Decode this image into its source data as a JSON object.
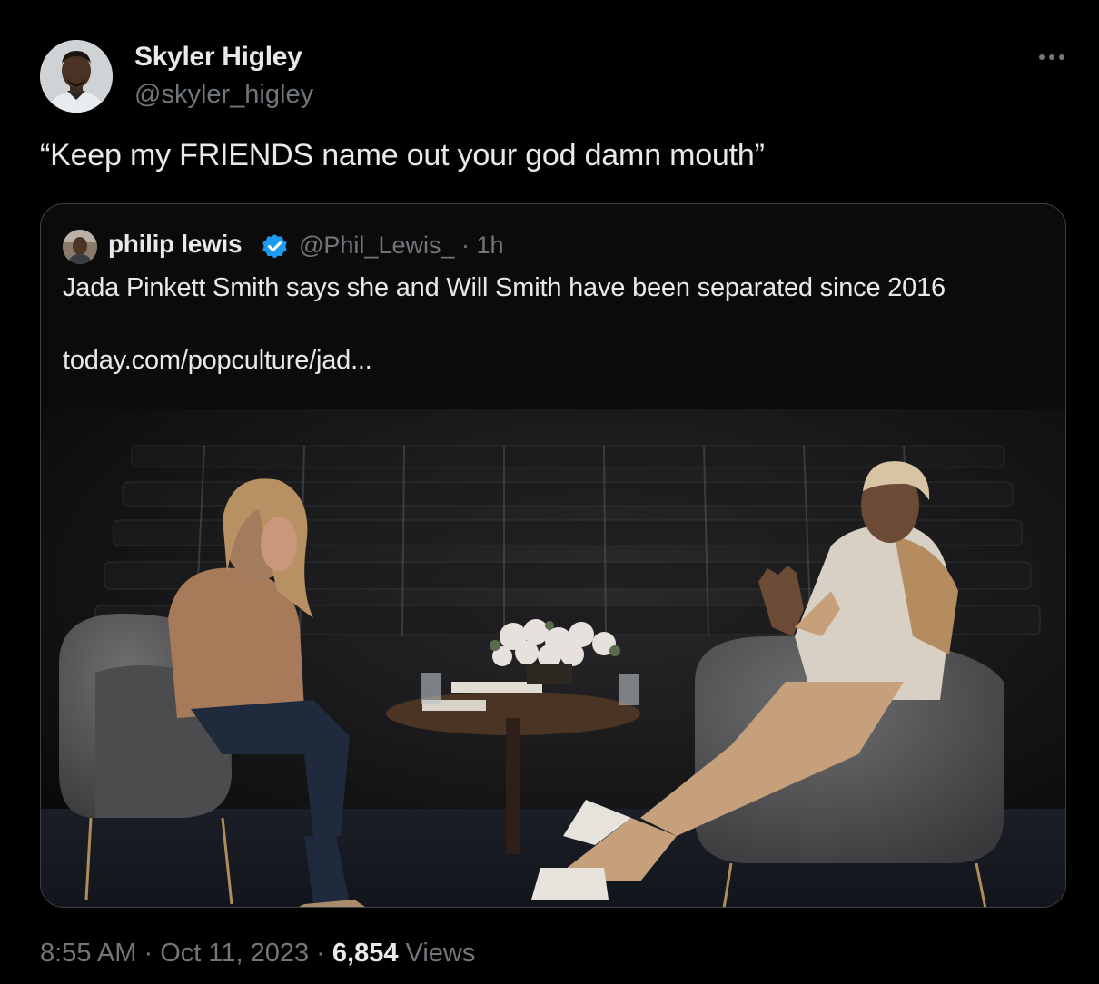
{
  "author": {
    "name": "Skyler Higley",
    "handle": "@skyler_higley"
  },
  "tweet": {
    "text": "“Keep my FRIENDS name out your god damn mouth”"
  },
  "quoted": {
    "name": "philip lewis",
    "handle": "@Phil_Lewis_",
    "separator": "·",
    "time": "1h",
    "text": "Jada Pinkett Smith says she and Will Smith have been separated since 2016",
    "link": "today.com/popculture/jad..."
  },
  "meta": {
    "time": "8:55 AM",
    "separator": "·",
    "date": "Oct 11, 2023",
    "views_count": "6,854",
    "views_label": "Views"
  },
  "icons": {
    "more": "more-horizontal-icon",
    "verified": "verified-badge-icon"
  },
  "colors": {
    "background": "#000000",
    "primary_text": "#e7e9ea",
    "secondary_text": "#71767b",
    "verified_blue": "#1d9bf0",
    "card_border": "#3e4144"
  }
}
